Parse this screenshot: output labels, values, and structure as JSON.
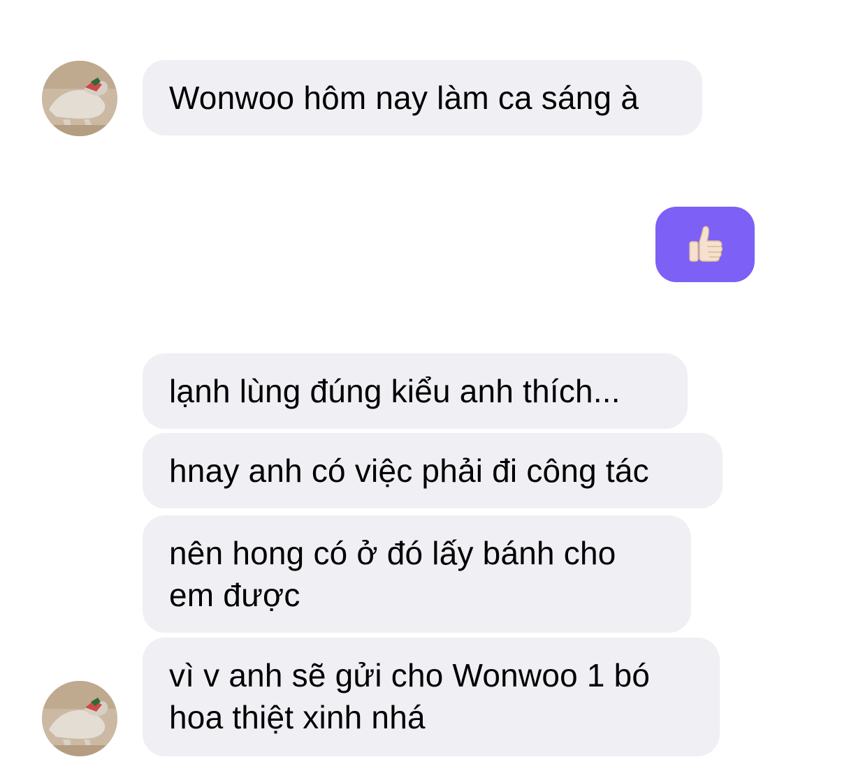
{
  "conversation": {
    "messages": [
      {
        "sender": "other",
        "text": "Wonwoo hôm nay làm ca sáng à"
      },
      {
        "sender": "me",
        "type": "like",
        "icon": "thumbs-up-icon"
      },
      {
        "sender": "other",
        "text": "lạnh lùng đúng kiểu anh thích..."
      },
      {
        "sender": "other",
        "text": "hnay anh có việc phải đi công tác"
      },
      {
        "sender": "other",
        "text": "nên hong có ở đó lấy bánh cho em được"
      },
      {
        "sender": "other",
        "text": "vì v anh sẽ gửi cho Wonwoo 1 bó hoa thiệt xinh nhá"
      }
    ]
  },
  "colors": {
    "received_bubble": "#efeff4",
    "sent_bubble": "#7d60f5",
    "text": "#000000"
  }
}
